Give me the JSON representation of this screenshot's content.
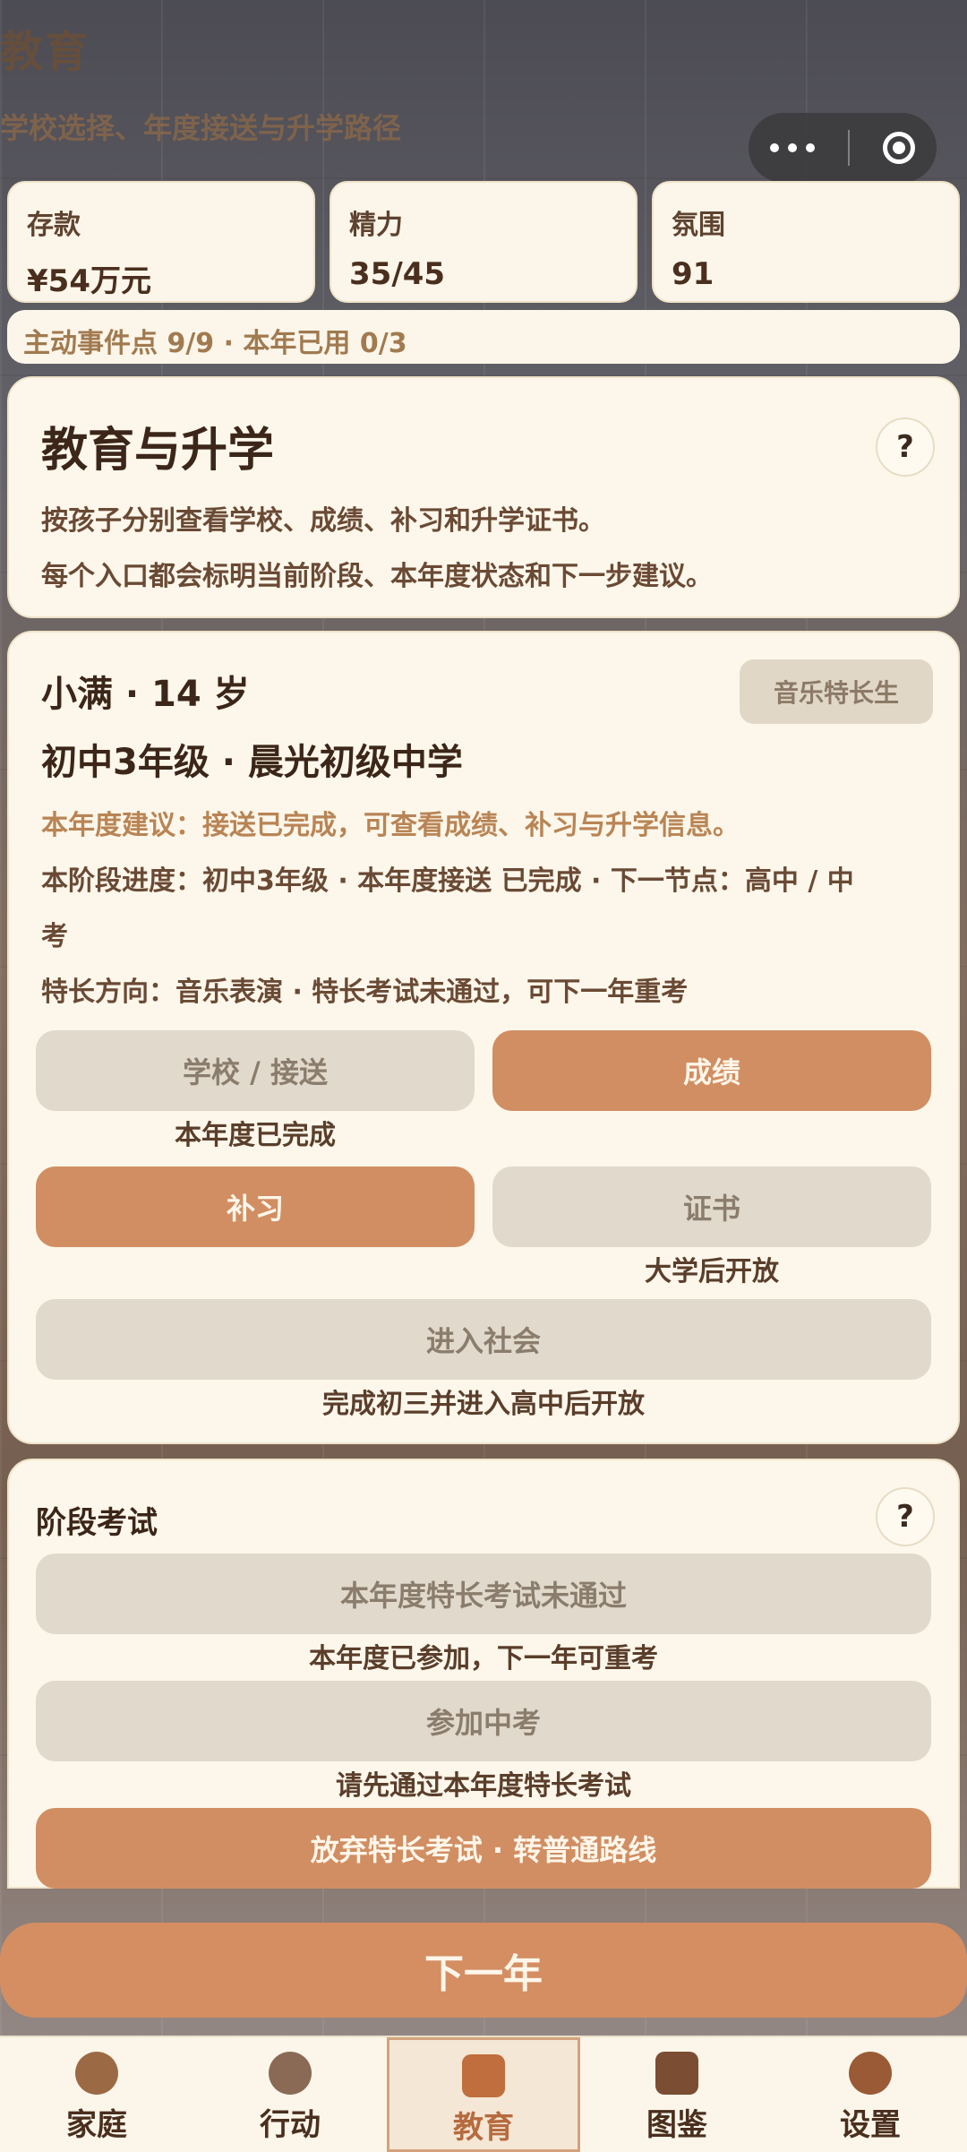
{
  "header": {
    "title": "教育",
    "subtitle": "学校选择、年度接送与升学路径"
  },
  "stats": [
    {
      "label": "存款",
      "value": "¥54万元"
    },
    {
      "label": "精力",
      "value": "35/45"
    },
    {
      "label": "氛围",
      "value": "91"
    }
  ],
  "events_line": "主动事件点 9/9 · 本年已用 0/3",
  "intro": {
    "title": "教育与升学",
    "help": "?",
    "line1": "按孩子分别查看学校、成绩、补习和升学证书。",
    "line2": "每个入口都会标明当前阶段、本年度状态和下一步建议。"
  },
  "child": {
    "name_age": "小满 · 14 岁",
    "tag": "音乐特长生",
    "stage_school": "初中3年级 · 晨光初级中学",
    "advice": "本年度建议：接送已完成，可查看成绩、补习与升学信息。",
    "progress_line1": "本阶段进度：初中3年级 · 本年度接送 已完成 · 下一节点：高中 / 中",
    "progress_line2": "考",
    "specialty": "特长方向：音乐表演 · 特长考试未通过，可下一年重考",
    "buttons": {
      "school": "学校 / 接送",
      "school_note": "本年度已完成",
      "grades": "成绩",
      "tutoring": "补习",
      "certificate": "证书",
      "certificate_note": "大学后开放",
      "society": "进入社会",
      "society_note": "完成初三并进入高中后开放"
    }
  },
  "exam": {
    "title": "阶段考试",
    "help": "?",
    "items": [
      {
        "label": "本年度特长考试未通过",
        "note": "本年度已参加，下一年可重考"
      },
      {
        "label": "参加中考",
        "note": "请先通过本年度特长考试"
      },
      {
        "label": "放弃特长考试 · 转普通路线"
      }
    ]
  },
  "next_year": "下一年",
  "tabs": [
    {
      "label": "家庭",
      "icon": "home-icon"
    },
    {
      "label": "行动",
      "icon": "action-icon"
    },
    {
      "label": "教育",
      "icon": "book-icon"
    },
    {
      "label": "图鉴",
      "icon": "album-icon"
    },
    {
      "label": "设置",
      "icon": "settings-icon"
    }
  ],
  "colors": {
    "accent": "#d18e62",
    "card_bg": "#fcf7ea",
    "disabled_bg": "#e1d9cb",
    "text_dark": "#3b2619"
  }
}
